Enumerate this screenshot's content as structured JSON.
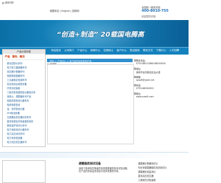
{
  "header": {
    "logo_alt": "深圳印码",
    "links": "收藏本站 | English | 招商网",
    "hotline_label": "全国统一服务热线",
    "hotline_number": "400-8010-755",
    "sub_text": "欢迎您的光临"
  },
  "banner": {
    "slogan": "“创造+制造” 20载国电腾高"
  },
  "nav": {
    "items": [
      "网站首页",
      "公司简介",
      "产品中心",
      "新闻中心",
      "招贤纳士",
      "客户中心",
      "售后服务",
      "联系方式",
      "下载中心",
      "人才招聘"
    ]
  },
  "sidebar": {
    "title": "产品分类列表",
    "heading": "产品、服务、解决",
    "items": [
      "振动控制仪系列",
      "电力电力通道器系列",
      "设定器分配器系列",
      "电阻箱电阻器系列",
      "工业级稳定电源系列",
      "安全检测台类型设备",
      "开关测试装置",
      "三相仿真电源校验仪器测试系",
      "测量仪、调整器系列产品",
      "电能质量检测仪器系列",
      "电线电缆检测",
      "油、化学检测仪器",
      "SF6检测设备",
      "互感器及变压器测试系列",
      "直流电源及充电装置检测系",
      "继电保护测试仪系列",
      "电力电缆测试仪器系列",
      "电力高压测试系列",
      "电力系统录波器",
      "电力高压发生器系列"
    ]
  },
  "content": {
    "crumb": "首页 > 产品中心 > 电力高压测试系列产品",
    "image_label": "产品图"
  },
  "right": {
    "lines": [
      "联系电话:",
      "0755-88011888 88000000",
      "地址:",
      "深圳市龙华新区民治大道",
      "邮箱:",
      "szsoft@yeah.net",
      "传真:",
      "0755-88000000",
      "网址:",
      "www.szsoft.com"
    ]
  },
  "bottom": {
    "mid_title": "避雷器类测试设备",
    "mid_body": "适用于各种电压等级的各类避雷器的检测试验设备，在产品的质量监督检验中发挥重要的作用。",
    "right_items": [
      "避雷器计数器测试仪",
      "氧化锌避雷器阻性电流测试仪",
      "避雷器在线监测仪",
      "直流高压发生器",
      "工频耐压试验装置"
    ]
  }
}
